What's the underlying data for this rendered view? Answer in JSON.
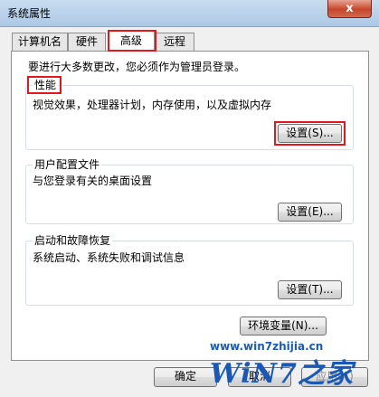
{
  "window": {
    "title": "系统属性",
    "close_symbol": "x"
  },
  "tabs": [
    {
      "label": "计算机名"
    },
    {
      "label": "硬件"
    },
    {
      "label": "高级"
    },
    {
      "label": "远程"
    }
  ],
  "admin_notice": "要进行大多数更改，您必须作为管理员登录。",
  "performance": {
    "title": "性能",
    "description": "视觉效果，处理器计划，内存使用，以及虚拟内存",
    "settings_label": "设置(S)..."
  },
  "user_profiles": {
    "title": "用户配置文件",
    "description": "与您登录有关的桌面设置",
    "settings_label": "设置(E)..."
  },
  "startup_recovery": {
    "title": "启动和故障恢复",
    "description": "系统启动、系统失败和调试信息",
    "settings_label": "设置(T)..."
  },
  "env_vars_label": "环境变量(N)...",
  "footer": {
    "ok_label": "确定",
    "cancel_label": "取消",
    "apply_label": "应用(A)"
  },
  "watermark": {
    "url": "www.win7zhijia.cn",
    "logo": "WiN7之家"
  },
  "colors": {
    "highlight": "#e3171c",
    "watermark_blue": "#1758b8"
  }
}
